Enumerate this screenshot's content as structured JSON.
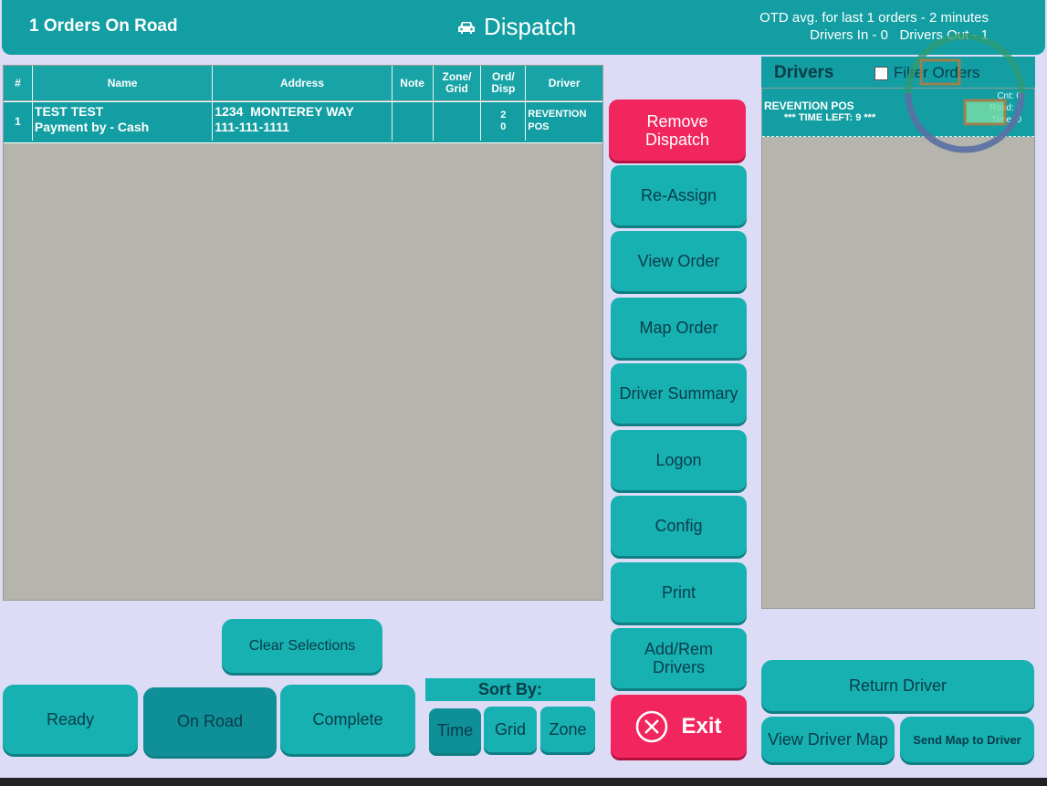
{
  "header": {
    "orders_on_road": "1 Orders On Road",
    "title": "Dispatch",
    "title_icon": "car-icon",
    "otd_line": "OTD avg. for last 1 orders - 2 minutes",
    "drivers_line": "Drivers In - 0   Drivers Out - 1"
  },
  "orders_table": {
    "columns": [
      "#",
      "Name",
      "Address",
      "Note",
      "Zone/\nGrid",
      "Ord/\nDisp",
      "Driver"
    ],
    "rows": [
      {
        "num": "1",
        "name_line1": "TEST TEST",
        "name_line2": "Payment by - Cash",
        "address_line1": "1234  MONTEREY WAY",
        "address_line2": "111-111-1111",
        "note": "",
        "zone_grid": "",
        "ord": "2",
        "disp": "0",
        "driver_line1": "REVENTION",
        "driver_line2": "POS"
      }
    ]
  },
  "actions": {
    "remove_dispatch": "Remove\nDispatch",
    "reassign": "Re-Assign",
    "view_order": "View Order",
    "map_order": "Map Order",
    "driver_summary": "Driver Summary",
    "logon": "Logon",
    "config": "Config",
    "print": "Print",
    "add_rem_drivers": "Add/Rem\nDrivers",
    "exit": "Exit"
  },
  "drivers_panel": {
    "title": "Drivers",
    "filter_label": "Filter Orders",
    "drivers": [
      {
        "name": "REVENTION POS",
        "time_left": "*** TIME LEFT: 9 ***",
        "cnt": "Cnt: 0",
        "road": "Road: 1",
        "time": "Time: 0"
      }
    ]
  },
  "bottom": {
    "clear_selections": "Clear Selections",
    "ready": "Ready",
    "on_road": "On Road",
    "complete": "Complete",
    "sort_by": "Sort By:",
    "sort_time": "Time",
    "sort_grid": "Grid",
    "sort_zone": "Zone",
    "return_driver": "Return Driver",
    "view_driver_map": "View Driver Map",
    "send_map": "Send Map to Driver"
  },
  "colors": {
    "teal": "#129ea2",
    "button": "#17b1b2",
    "red": "#f1265f",
    "background": "#dcdcf6",
    "panel_gray": "#b5b5ad"
  }
}
